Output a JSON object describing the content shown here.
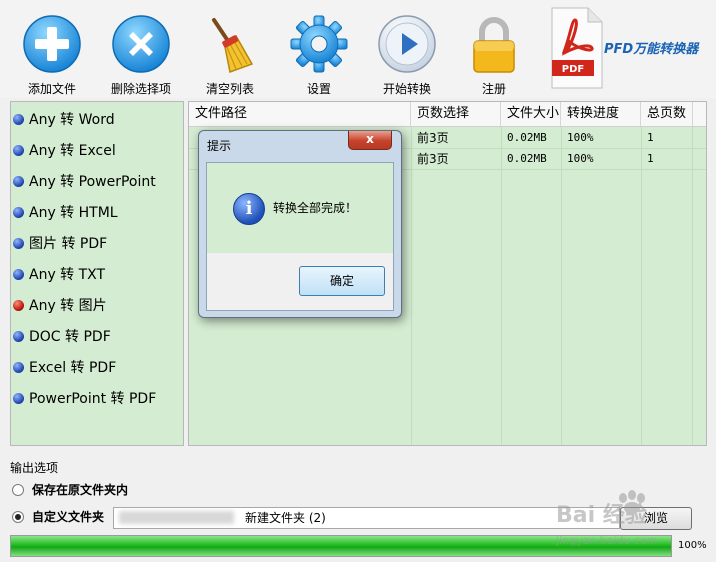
{
  "toolbar": {
    "items": [
      {
        "label": "添加文件",
        "icon": "plus-icon"
      },
      {
        "label": "删除选择项",
        "icon": "x-icon"
      },
      {
        "label": "清空列表",
        "icon": "broom-icon"
      },
      {
        "label": "设置",
        "icon": "gear-icon"
      },
      {
        "label": "开始转换",
        "icon": "play-icon"
      },
      {
        "label": "注册",
        "icon": "lock-icon"
      }
    ],
    "logo_text": "PFD万能转换器",
    "logo_badge": "PDF"
  },
  "conversions": [
    {
      "label": "Any 转 Word",
      "active": false
    },
    {
      "label": "Any 转 Excel",
      "active": false
    },
    {
      "label": "Any 转 PowerPoint",
      "active": false
    },
    {
      "label": "Any 转 HTML",
      "active": false
    },
    {
      "label": "图片 转 PDF",
      "active": false
    },
    {
      "label": "Any 转 TXT",
      "active": false
    },
    {
      "label": "Any 转 图片",
      "active": true
    },
    {
      "label": "DOC 转 PDF",
      "active": false
    },
    {
      "label": "Excel 转 PDF",
      "active": false
    },
    {
      "label": "PowerPoint 转 PDF",
      "active": false
    }
  ],
  "table": {
    "columns": [
      "文件路径",
      "页数选择",
      "文件大小",
      "转换进度",
      "总页数"
    ],
    "rows": [
      {
        "pages": "前3页",
        "size": "0.02MB",
        "progress": "100%",
        "total": "1"
      },
      {
        "pages": "前3页",
        "size": "0.02MB",
        "progress": "100%",
        "total": "1"
      }
    ]
  },
  "dialog": {
    "title": "提示",
    "close": "x",
    "message": "转换全部完成！",
    "ok_label": "确定"
  },
  "output": {
    "title": "输出选项",
    "option_original": "保存在原文件夹内",
    "option_custom": "自定义文件夹",
    "selected": "custom",
    "path_value": "新建文件夹 (2)",
    "browse_label": "浏览"
  },
  "progress": {
    "value": 1.0,
    "text": "100%"
  },
  "watermark": {
    "brand": "Bai 经验",
    "url": "jingyan.baidu.com"
  },
  "colors": {
    "panel_bg": "#d4ecd1",
    "progress_green": "#1fbe1f",
    "logo_blue": "#1a63b5",
    "close_red": "#c7422b"
  }
}
